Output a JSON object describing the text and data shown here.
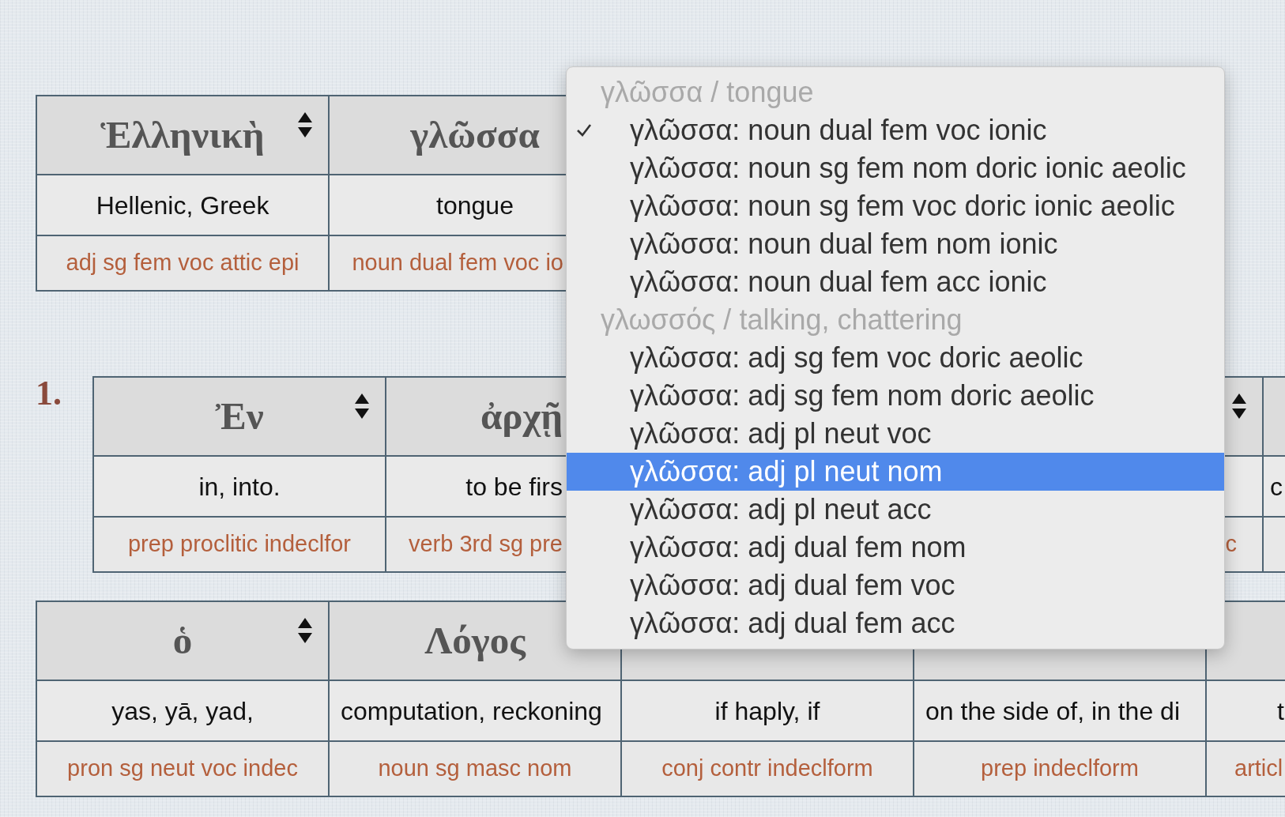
{
  "tables": [
    {
      "columns": [
        {
          "header": "Ἑλληνικὴ",
          "sorter": true,
          "meaning": "Hellenic, Greek",
          "parse": "adj sg fem voc attic epi"
        },
        {
          "header": "γλῶσσα",
          "meaning": "tongue",
          "parse": "noun dual fem voc io"
        }
      ]
    },
    {
      "label": "1.",
      "columns": [
        {
          "header": "Ἐν",
          "sorter": true,
          "meaning": "in, into.",
          "parse": "prep proclitic indeclfor"
        },
        {
          "header": "ἀρχῇ",
          "meaning": "to be firs",
          "parse": "verb 3rd sg pre"
        },
        {},
        {
          "sorter": true,
          "parse": "c"
        },
        {
          "meaning": "c"
        }
      ]
    },
    {
      "columns": [
        {
          "header": "ὁ",
          "sorter": true,
          "meaning": "yas, yā, yad,",
          "parse": "pron sg neut voc indec"
        },
        {
          "header": "Λόγος",
          "meaning": "computation, reckoning",
          "parse": "noun sg masc nom"
        },
        {
          "meaning": "if haply, if",
          "parse": "conj contr indeclform"
        },
        {
          "meaning": "on the side of, in the di",
          "parse": "prep indeclform"
        },
        {
          "meaning": "t",
          "parse": "articl"
        }
      ]
    }
  ],
  "menu": {
    "items": [
      {
        "kind": "group",
        "text": "γλῶσσα / tongue"
      },
      {
        "kind": "option",
        "text": "γλῶσσα: noun dual fem voc ionic",
        "selected": true,
        "highlighted": false
      },
      {
        "kind": "option",
        "text": "γλῶσσα: noun sg fem nom doric ionic aeolic",
        "selected": false,
        "highlighted": false
      },
      {
        "kind": "option",
        "text": "γλῶσσα: noun sg fem voc doric ionic aeolic",
        "selected": false,
        "highlighted": false
      },
      {
        "kind": "option",
        "text": "γλῶσσα: noun dual fem nom ionic",
        "selected": false,
        "highlighted": false
      },
      {
        "kind": "option",
        "text": "γλῶσσα: noun dual fem acc ionic",
        "selected": false,
        "highlighted": false
      },
      {
        "kind": "group",
        "text": "γλωσσός / talking, chattering"
      },
      {
        "kind": "option",
        "text": "γλῶσσα: adj sg fem voc doric aeolic",
        "selected": false,
        "highlighted": false
      },
      {
        "kind": "option",
        "text": "γλῶσσα: adj sg fem nom doric aeolic",
        "selected": false,
        "highlighted": false
      },
      {
        "kind": "option",
        "text": "γλῶσσα: adj pl neut voc",
        "selected": false,
        "highlighted": false
      },
      {
        "kind": "option",
        "text": "γλῶσσα: adj pl neut nom",
        "selected": false,
        "highlighted": true
      },
      {
        "kind": "option",
        "text": "γλῶσσα: adj pl neut acc",
        "selected": false,
        "highlighted": false
      },
      {
        "kind": "option",
        "text": "γλῶσσα: adj dual fem nom",
        "selected": false,
        "highlighted": false
      },
      {
        "kind": "option",
        "text": "γλῶσσα: adj dual fem voc",
        "selected": false,
        "highlighted": false
      },
      {
        "kind": "option",
        "text": "γλῶσσα: adj dual fem acc",
        "selected": false,
        "highlighted": false
      }
    ]
  }
}
